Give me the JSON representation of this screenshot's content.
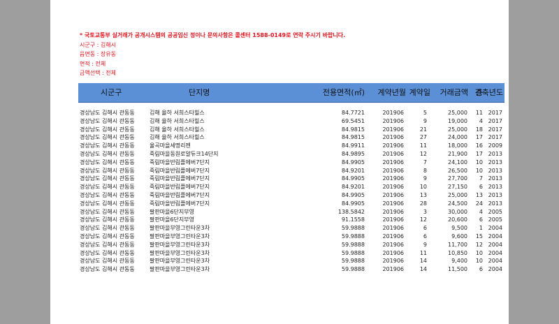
{
  "notes": [
    "* 국토교통부 실거래가 공개시스템의 공공임신 정이나 문의사항은 콜센터 1588-0149로 연락 주시기 바랍니다.",
    "시군구 : 김해시",
    "읍면동 : 장유동",
    "면적 : 전체",
    "금액선택 : 전체"
  ],
  "table": {
    "headers": [
      "시군구",
      "단지명",
      "전용면적(㎡)",
      "계약년월",
      "계약일",
      "거래금액",
      "층",
      "건축년도"
    ],
    "rows": [
      [
        "경상남도 김해시 관동동",
        "김해 율하 서희스타힐스",
        "84.7721",
        "201906",
        "5",
        "25,000",
        "11",
        "2017"
      ],
      [
        "경상남도 김해시 관동동",
        "김해 율하 서희스타힐스",
        "69.5451",
        "201906",
        "9",
        "19,000",
        "4",
        "2017"
      ],
      [
        "경상남도 김해시 관동동",
        "김해 율하 서희스타힐스",
        "84.9815",
        "201906",
        "21",
        "25,000",
        "18",
        "2017"
      ],
      [
        "경상남도 김해시 관동동",
        "김해 율하 서희스타힐스",
        "84.9815",
        "201906",
        "27",
        "24,000",
        "17",
        "2017"
      ],
      [
        "경상남도 김해시 관동동",
        "율곡마을세명리젠",
        "84.9911",
        "201906",
        "11",
        "18,000",
        "16",
        "2009"
      ],
      [
        "경상남도 김해시 관동동",
        "죽림마을동원로얄듀크14단지",
        "84.9895",
        "201906",
        "12",
        "21,900",
        "17",
        "2013"
      ],
      [
        "경상남도 김해시 관동동",
        "죽림마을반림플에버7단지",
        "84.9905",
        "201906",
        "7",
        "24,100",
        "10",
        "2013"
      ],
      [
        "경상남도 김해시 관동동",
        "죽림마을반림플에버7단지",
        "84.9201",
        "201906",
        "8",
        "26,500",
        "10",
        "2013"
      ],
      [
        "경상남도 김해시 관동동",
        "죽림마을반림플에버7단지",
        "84.9905",
        "201906",
        "9",
        "27,700",
        "7",
        "2013"
      ],
      [
        "경상남도 김해시 관동동",
        "죽림마을반림플에버7단지",
        "84.9201",
        "201906",
        "10",
        "27,150",
        "6",
        "2013"
      ],
      [
        "경상남도 김해시 관동동",
        "죽림마을반림플에버7단지",
        "84.9905",
        "201906",
        "13",
        "25,000",
        "13",
        "2013"
      ],
      [
        "경상남도 김해시 관동동",
        "죽림마을반림플에버7단지",
        "84.9905",
        "201906",
        "28",
        "24,500",
        "24",
        "2013"
      ],
      [
        "경상남도 김해시 관동동",
        "팔판마을6단지부영",
        "138.5842",
        "201906",
        "3",
        "30,000",
        "4",
        "2005"
      ],
      [
        "경상남도 김해시 관동동",
        "팔판마을6단지부영",
        "91.1558",
        "201906",
        "12",
        "20,600",
        "6",
        "2005"
      ],
      [
        "경상남도 김해시 관동동",
        "팔판마을부영그린타운3차",
        "59.9888",
        "201906",
        "6",
        "9,500",
        "1",
        "2004"
      ],
      [
        "경상남도 김해시 관동동",
        "팔판마을부영그린타운3차",
        "59.9888",
        "201906",
        "6",
        "9,600",
        "15",
        "2004"
      ],
      [
        "경상남도 김해시 관동동",
        "팔판마을부영그린타운3차",
        "59.9888",
        "201906",
        "9",
        "11,700",
        "12",
        "2004"
      ],
      [
        "경상남도 김해시 관동동",
        "팔판마을부영그린타운3차",
        "59.9888",
        "201906",
        "11",
        "10,850",
        "10",
        "2004"
      ],
      [
        "경상남도 김해시 관동동",
        "팔판마을부영그린타운3차",
        "59.9888",
        "201906",
        "14",
        "9,400",
        "10",
        "2004"
      ],
      [
        "경상남도 김해시 관동동",
        "팔판마을부영그린타운3차",
        "59.9888",
        "201906",
        "14",
        "11,500",
        "6",
        "2004"
      ]
    ]
  }
}
